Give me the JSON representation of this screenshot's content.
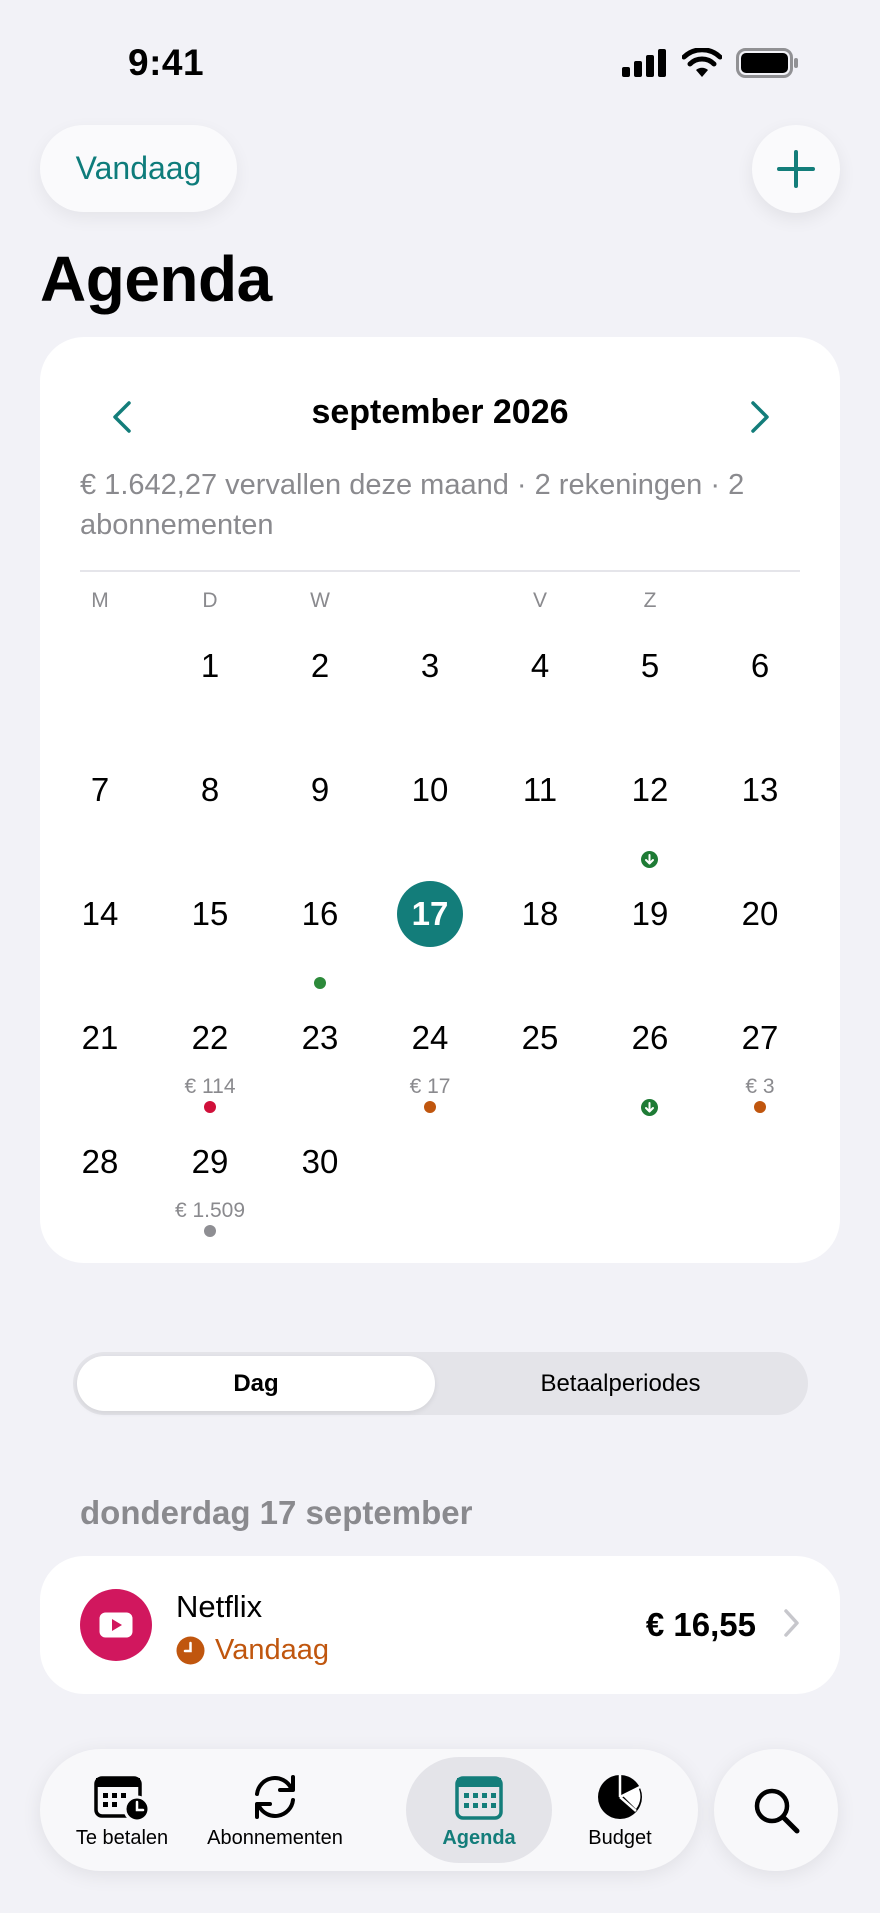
{
  "status_bar": {
    "time": "9:41"
  },
  "header": {
    "today_label": "Vandaag",
    "title": "Agenda"
  },
  "calendar": {
    "month": "september 2026",
    "summary": "€ 1.642,27 vervallen deze maand · 2 rekeningen · 2 abonnementen",
    "weekdays": [
      "M",
      "D",
      "W",
      "",
      "V",
      "Z",
      ""
    ],
    "selected_day": 17,
    "days": [
      {
        "day": "1"
      },
      {
        "day": "2"
      },
      {
        "day": "3"
      },
      {
        "day": "4"
      },
      {
        "day": "5"
      },
      {
        "day": "6"
      },
      {
        "day": "7"
      },
      {
        "day": "8"
      },
      {
        "day": "9"
      },
      {
        "day": "10"
      },
      {
        "day": "11"
      },
      {
        "day": "12",
        "marker": "income",
        "marker_color": "#1E7B35"
      },
      {
        "day": "13"
      },
      {
        "day": "14"
      },
      {
        "day": "15"
      },
      {
        "day": "16",
        "marker": "dot",
        "marker_color": "#2C8A3A"
      },
      {
        "day": "17"
      },
      {
        "day": "18"
      },
      {
        "day": "19"
      },
      {
        "day": "20"
      },
      {
        "day": "21"
      },
      {
        "day": "22",
        "amount": "€ 114",
        "marker": "dot",
        "marker_color": "#D0103A"
      },
      {
        "day": "23"
      },
      {
        "day": "24",
        "amount": "€ 17",
        "marker": "dot",
        "marker_color": "#C0560E"
      },
      {
        "day": "25"
      },
      {
        "day": "26",
        "marker": "income",
        "marker_color": "#1E7B35"
      },
      {
        "day": "27",
        "amount": "€ 3",
        "marker": "dot",
        "marker_color": "#C0560E"
      },
      {
        "day": "28"
      },
      {
        "day": "29",
        "amount": "€ 1.509",
        "marker": "dot",
        "marker_color": "#8E8E93"
      },
      {
        "day": "30"
      }
    ]
  },
  "segmented": {
    "day_label": "Dag",
    "periods_label": "Betaalperiodes"
  },
  "day_section": {
    "heading": "donderdag 17 september",
    "item": {
      "name": "Netflix",
      "status": "Vandaag",
      "amount": "€ 16,55",
      "icon": "play-icon",
      "icon_color": "#D1175E"
    }
  },
  "tab_bar": {
    "tabs": [
      {
        "label": "Te betalen",
        "icon": "calendar-clock-icon"
      },
      {
        "label": "Abonnementen",
        "icon": "refresh-icon"
      },
      {
        "label": "Agenda",
        "icon": "calendar-grid-icon"
      },
      {
        "label": "Budget",
        "icon": "pie-chart-icon"
      }
    ],
    "active_tab": "Agenda"
  },
  "colors": {
    "accent": "#137D7A",
    "background": "#F2F2F7",
    "warning": "#C0560E"
  }
}
